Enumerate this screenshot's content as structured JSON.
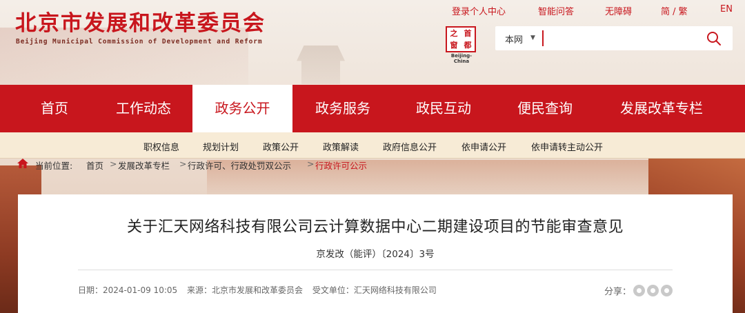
{
  "header": {
    "site_title": "北京市发展和改革委员会",
    "site_subtitle": "Beijing Municipal Commission of Development and Reform",
    "top_links": [
      "登录个人中心",
      "智能问答",
      "无障碍",
      "简 / 繁",
      "EN"
    ],
    "seal": {
      "chars": [
        "首",
        "之",
        "都",
        "窗"
      ],
      "caption": "Beijing-China"
    }
  },
  "search": {
    "scope": "本网",
    "value": "",
    "placeholder": ""
  },
  "nav": {
    "items": [
      "首页",
      "工作动态",
      "政务公开",
      "政务服务",
      "政民互动",
      "便民查询",
      "发展改革专栏"
    ],
    "active": "政务公开"
  },
  "subnav": {
    "items": [
      "职权信息",
      "规划计划",
      "政策公开",
      "政策解读",
      "政府信息公开",
      "依申请公开",
      "依申请转主动公开"
    ]
  },
  "breadcrumb": {
    "label": "当前位置:",
    "items": [
      "首页",
      "发展改革专栏",
      "行政许可、行政处罚双公示",
      "行政许可公示"
    ],
    "separator": ">"
  },
  "article": {
    "title": "关于汇天网络科技有限公司云计算数据中心二期建设项目的节能审查意见",
    "doc_number": "京发改（能评）〔2024〕3号",
    "date": "日期：2024-01-09 10:05",
    "source": "来源：北京市发展和改革委员会",
    "recipient": "受文单位：汇天网络科技有限公司",
    "share_label": "分享："
  },
  "colors": {
    "brand_red": "#c8161d",
    "subnav_bg": "#f7ebd6"
  }
}
